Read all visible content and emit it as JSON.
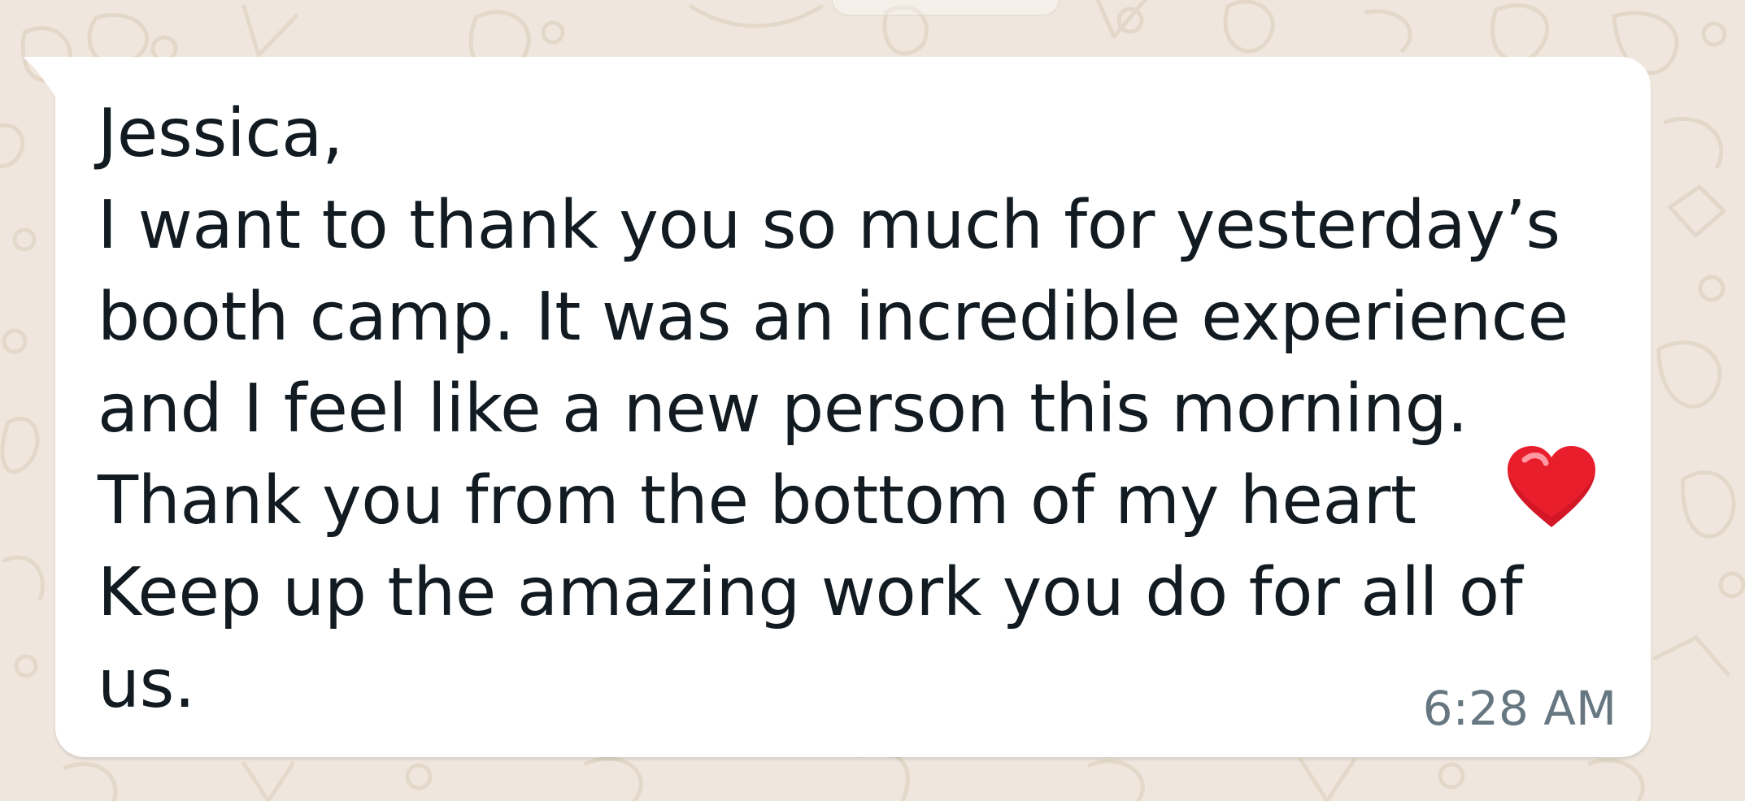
{
  "chat": {
    "message": {
      "lines": [
        "Jessica,",
        "I want to thank you so much for yesterday’s",
        "booth camp. It was an incredible experience",
        "and I feel like a new person this morning.",
        "Thank you from the bottom of my heart",
        "Keep up the amazing work you do for all of",
        "us."
      ],
      "emoji": "heart-icon",
      "timestamp": "6:28 AM"
    }
  },
  "colors": {
    "wallpaper": "#efe7dd",
    "bubble": "#ffffff",
    "text": "#111b21",
    "timestamp": "#667781",
    "heart": "#e81e2d"
  }
}
